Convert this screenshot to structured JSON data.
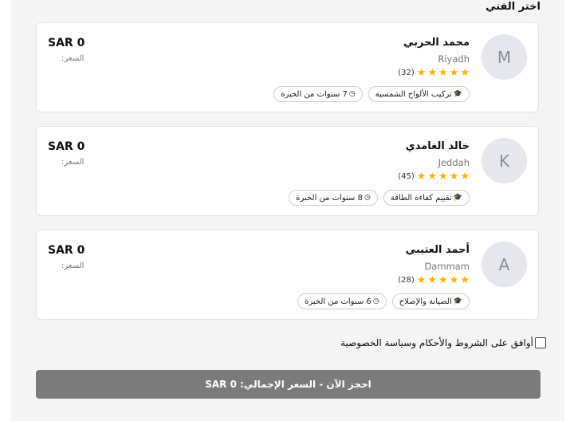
{
  "section_title": "اختر الفني",
  "price_label": "السعر:",
  "technicians": [
    {
      "initial": "M",
      "name": "محمد الحربي",
      "city": "Riyadh",
      "rating_count": "(32)",
      "stars": 5,
      "specialty": "تركيب الألواح الشمسية",
      "experience": "7 سنوات من الخبرة",
      "price": "SAR 0"
    },
    {
      "initial": "K",
      "name": "خالد الغامدي",
      "city": "Jeddah",
      "rating_count": "(45)",
      "stars": 5,
      "specialty": "تقييم كفاءة الطاقة",
      "experience": "8 سنوات من الخبرة",
      "price": "SAR 0"
    },
    {
      "initial": "A",
      "name": "أحمد العتيبي",
      "city": "Dammam",
      "rating_count": "(28)",
      "stars": 5,
      "specialty": "الصيانة والإصلاح",
      "experience": "6 سنوات من الخبرة",
      "price": "SAR 0"
    }
  ],
  "terms_text": "أوافق على الشروط والأحكام وسياسة الخصوصية",
  "book_button": "احجز الآن - السعر الإجمالي: SAR 0",
  "colors": {
    "star": "#f4b400",
    "button": "#7b7b7b",
    "avatar_bg": "#e6e7ec"
  },
  "icons": {
    "specialty": "graduation-cap-icon",
    "experience": "clock-icon",
    "rating": "star-icon"
  }
}
